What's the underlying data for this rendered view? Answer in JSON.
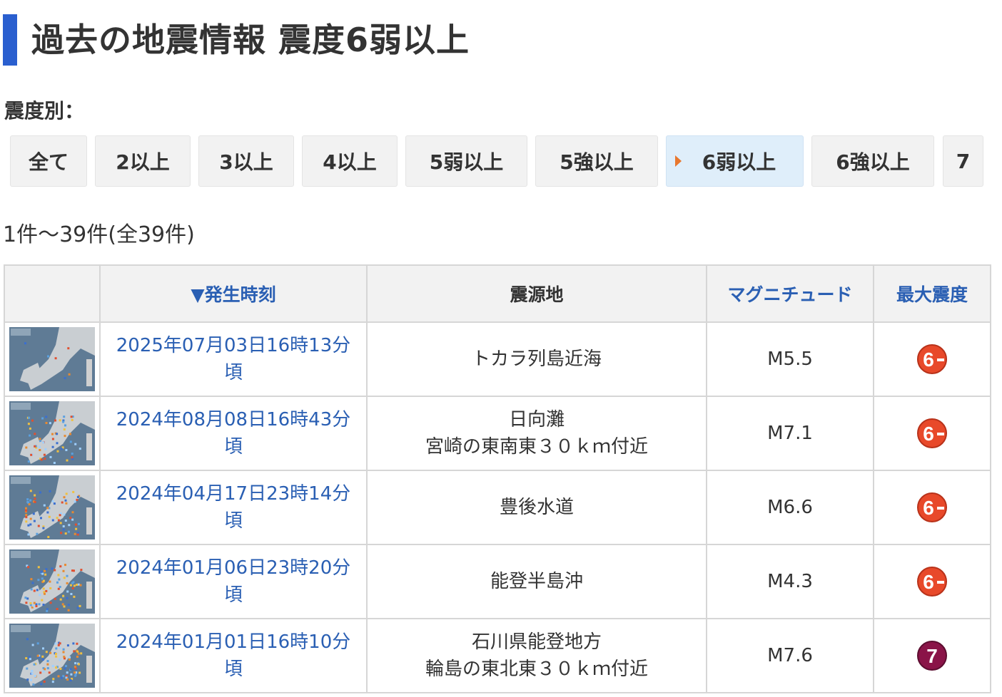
{
  "page": {
    "title": "過去の地震情報 震度6弱以上",
    "filter_label": "震度別：",
    "result_count": "1件～39件(全39件)"
  },
  "filters": [
    {
      "label": "全て",
      "active": false
    },
    {
      "label": "2以上",
      "active": false
    },
    {
      "label": "3以上",
      "active": false
    },
    {
      "label": "4以上",
      "active": false
    },
    {
      "label": "5弱以上",
      "active": false
    },
    {
      "label": "5強以上",
      "active": false
    },
    {
      "label": "6弱以上",
      "active": true
    },
    {
      "label": "6強以上",
      "active": false
    },
    {
      "label": "7",
      "active": false
    }
  ],
  "table": {
    "headers": {
      "thumbnail": "",
      "time": "▼発生時刻",
      "epicenter": "震源地",
      "magnitude": "マグニチュード",
      "max_intensity": "最大震度"
    },
    "rows": [
      {
        "time_line1": "2025年07月03日16時13分",
        "time_line2": "頃",
        "epicenter_line1": "トカラ列島近海",
        "epicenter_line2": "",
        "magnitude": "M5.5",
        "intensity": "6-"
      },
      {
        "time_line1": "2024年08月08日16時43分",
        "time_line2": "頃",
        "epicenter_line1": "日向灘",
        "epicenter_line2": "宮崎の東南東３０ｋｍ付近",
        "magnitude": "M7.1",
        "intensity": "6-"
      },
      {
        "time_line1": "2024年04月17日23時14分",
        "time_line2": "頃",
        "epicenter_line1": "豊後水道",
        "epicenter_line2": "",
        "magnitude": "M6.6",
        "intensity": "6-"
      },
      {
        "time_line1": "2024年01月06日23時20分",
        "time_line2": "頃",
        "epicenter_line1": "能登半島沖",
        "epicenter_line2": "",
        "magnitude": "M4.3",
        "intensity": "6-"
      },
      {
        "time_line1": "2024年01月01日16時10分",
        "time_line2": "頃",
        "epicenter_line1": "石川県能登地方",
        "epicenter_line2": "輪島の東北東３０ｋｍ付近",
        "magnitude": "M7.6",
        "intensity": "7"
      }
    ]
  },
  "colors": {
    "accent_bar": "#2a5fcf",
    "link": "#2a5fb3",
    "active_tab_bg": "#dfeefa",
    "intensity_6_lower": "#e8492a",
    "intensity_7": "#8a1448"
  },
  "icons": {
    "active_marker": "triangle-right-icon",
    "intensity_6_lower": "intensity-6-lower-badge",
    "intensity_7": "intensity-7-badge"
  }
}
